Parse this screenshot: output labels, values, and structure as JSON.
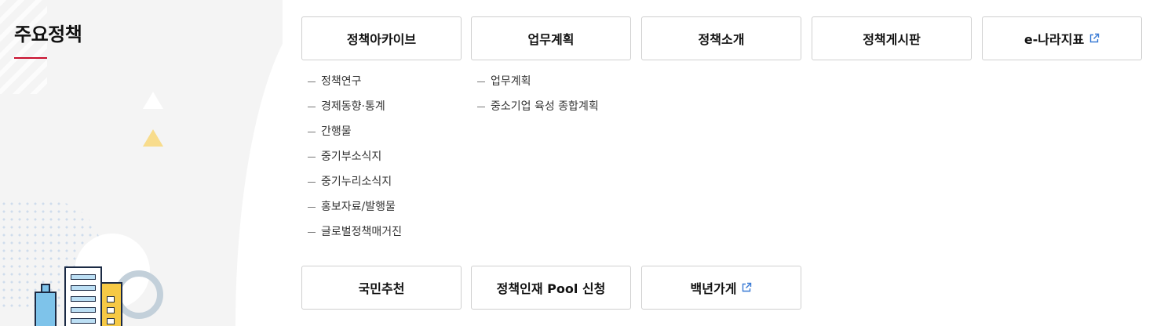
{
  "section": {
    "title": "주요정책"
  },
  "menu_row1": [
    {
      "label": "정책아카이브",
      "external": false
    },
    {
      "label": "업무계획",
      "external": false
    },
    {
      "label": "정책소개",
      "external": false
    },
    {
      "label": "정책게시판",
      "external": false
    },
    {
      "label": "e-나라지표",
      "external": true,
      "icon": "external-link-icon"
    }
  ],
  "archive_sub": [
    "정책연구",
    "경제동향·통계",
    "간행물",
    "중기부소식지",
    "중기누리소식지",
    "홍보자료/발행물",
    "글로벌정책매거진"
  ],
  "plan_sub": [
    "업무계획",
    "중소기업 육성 종합계획"
  ],
  "menu_row2": [
    {
      "label": "국민추천",
      "external": false
    },
    {
      "label": "정책인재 Pool 신청",
      "external": false
    },
    {
      "label": "백년가게",
      "external": true,
      "icon": "external-link-icon"
    }
  ],
  "colors": {
    "accent_red": "#c8102e",
    "link_blue": "#3a7bd5",
    "panel_bg": "#f4f4f4"
  }
}
